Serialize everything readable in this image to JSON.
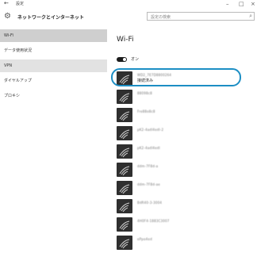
{
  "window": {
    "title": "設定",
    "back_icon": "back-arrow-icon",
    "controls": [
      "–",
      "□",
      "×"
    ]
  },
  "header": {
    "title": "ネットワークとインターネット",
    "icon": "gear-icon",
    "search_placeholder": "設定の検索",
    "search_icon": "search-icon"
  },
  "sidebar": {
    "items": [
      {
        "label": "Wi-Fi",
        "selected": true
      },
      {
        "label": "データ使用状況",
        "selected": false
      },
      {
        "label": "VPN",
        "selected": true
      },
      {
        "label": "ダイヤルアップ",
        "selected": false
      },
      {
        "label": "プロキシ",
        "selected": false
      }
    ]
  },
  "main": {
    "title": "Wi-Fi",
    "toggle_label": "オン",
    "networks": [
      {
        "name": "WD2_7E7D8800264",
        "status": "接続済み"
      },
      {
        "name": "88098c8",
        "status": ""
      },
      {
        "name": "Fre88o8c8",
        "status": ""
      },
      {
        "name": "pK2-4adl4edl-2",
        "status": ""
      },
      {
        "name": "pK2-4adl4edl",
        "status": ""
      },
      {
        "name": "ddm-7F8d-a",
        "status": ""
      },
      {
        "name": "ddm-7F8d-ae",
        "status": ""
      },
      {
        "name": "BdR40-3-3004",
        "status": ""
      },
      {
        "name": "4H0F4-1883C3007",
        "status": ""
      },
      {
        "name": "ePpo4ed",
        "status": ""
      }
    ]
  },
  "colors": {
    "highlight": "#1c8ec4",
    "selected_bg": "#cfcfcf",
    "icon_bg": "#2f2f2f"
  }
}
